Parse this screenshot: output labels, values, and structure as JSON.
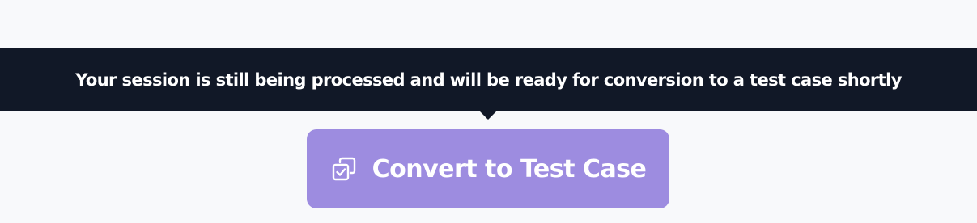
{
  "tooltip": {
    "text": "Your session is still being processed and will be ready for conversion to a test case shortly"
  },
  "convert_button": {
    "label": "Convert to Test Case",
    "icon": "copy-check-icon",
    "state": "disabled"
  },
  "colors": {
    "background": "#f8f9fb",
    "tooltip_bg": "#111827",
    "button_bg": "#9d8ce0",
    "text_on_dark": "#ffffff"
  }
}
